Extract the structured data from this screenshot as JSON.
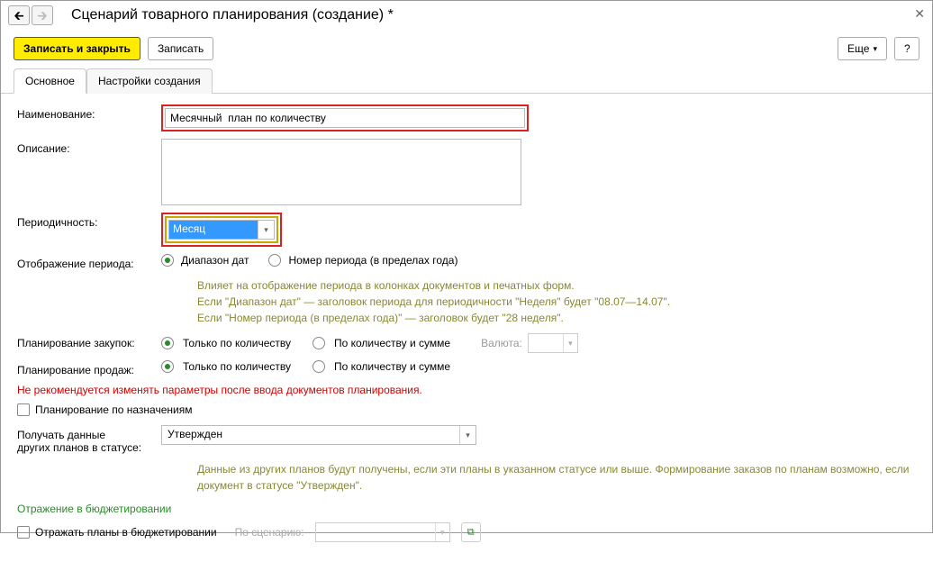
{
  "window": {
    "title": "Сценарий товарного планирования (создание) *"
  },
  "toolbar": {
    "save_close": "Записать и закрыть",
    "save": "Записать",
    "more": "Еще",
    "help": "?"
  },
  "tabs": {
    "main": "Основное",
    "settings": "Настройки создания"
  },
  "fields": {
    "name_label": "Наименование:",
    "name_value": "Месячный  план по количеству",
    "desc_label": "Описание:",
    "desc_value": "",
    "period_label": "Периодичность:",
    "period_value": "Месяц",
    "display_label": "Отображение периода:",
    "display_opt1": "Диапазон дат",
    "display_opt2": "Номер периода (в пределах года)",
    "display_hint1": "Влияет на отображение периода в колонках документов и печатных форм.",
    "display_hint2": "Если \"Диапазон дат\" — заголовок периода для периодичности \"Неделя\" будет \"08.07—14.07\".",
    "display_hint3": "Если \"Номер периода (в пределах года)\" — заголовок будет \"28 неделя\".",
    "purch_label": "Планирование закупок:",
    "sales_label": "Планирование продаж:",
    "plan_opt1": "Только по количеству",
    "plan_opt2": "По количеству и сумме",
    "currency_label": "Валюта:",
    "warn": "Не рекомендуется изменять параметры после ввода документов планирования.",
    "by_purpose": "Планирование по назначениям",
    "other_plans_label1": "Получать данные",
    "other_plans_label2": "других планов в статусе:",
    "status_value": "Утвержден",
    "status_hint": "Данные из других планов будут получены, если эти планы в указанном статусе или выше. Формирование заказов по планам возможно, если документ в статусе \"Утвержден\".",
    "budget_section": "Отражение в бюджетировании",
    "budget_check": "Отражать планы в бюджетировании",
    "scenario_label": "По сценарию:"
  }
}
